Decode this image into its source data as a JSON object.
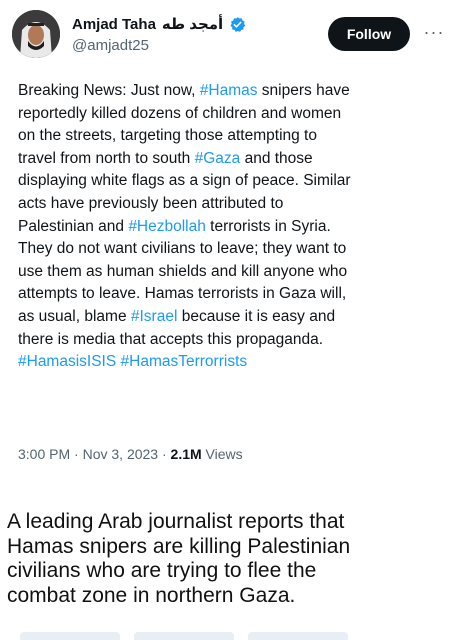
{
  "tweet": {
    "author_name": "Amjad Taha",
    "author_name_arabic": "أمجد طه",
    "handle": "@amjadt25",
    "follow_label": "Follow",
    "more_label": "···",
    "lines": [
      [
        {
          "t": "Breaking News: Just now, "
        },
        {
          "t": "#Hamas",
          "tag": true
        },
        {
          "t": " snipers have"
        }
      ],
      [
        {
          "t": "reportedly killed dozens of children and women"
        }
      ],
      [
        {
          "t": "on the streets, targeting those attempting to"
        }
      ],
      [
        {
          "t": "travel from north to south "
        },
        {
          "t": "#Gaza",
          "tag": true
        },
        {
          "t": " and those"
        }
      ],
      [
        {
          "t": "displaying white flags as a sign of peace. Similar"
        }
      ],
      [
        {
          "t": "acts have previously been attributed to"
        }
      ],
      [
        {
          "t": "Palestinian and "
        },
        {
          "t": "#Hezbollah",
          "tag": true
        },
        {
          "t": " terrorists in Syria."
        }
      ],
      [
        {
          "t": "They do not want civilians to leave; they want to"
        }
      ],
      [
        {
          "t": "use them as human shields and kill anyone who"
        }
      ],
      [
        {
          "t": "attempts to leave. Hamas terrorists in Gaza will,"
        }
      ],
      [
        {
          "t": "as usual, blame "
        },
        {
          "t": "#Israel",
          "tag": true
        },
        {
          "t": " because it is easy and"
        }
      ],
      [
        {
          "t": "there is media that accepts this propaganda."
        }
      ],
      [
        {
          "t": "#HamasisISIS",
          "tag": true
        },
        {
          "t": " "
        },
        {
          "t": "#HamasTerrorrists",
          "tag": true
        }
      ]
    ],
    "time": "3:00 PM",
    "separator": " · ",
    "date": "Nov 3, 2023",
    "views_count": "2.1M",
    "views_label": " Views"
  },
  "caption": {
    "lines": [
      "A leading Arab journalist reports that",
      "Hamas snipers are killing Palestinian",
      "civilians who are trying to flee the",
      "combat zone in northern Gaza."
    ]
  },
  "colors": {
    "hashtag": "#1d9bf0",
    "verified": "#1d9bf0",
    "follow_bg": "#0f1419",
    "secondary_text": "#536471"
  },
  "icons": {
    "verified": "verified-badge-icon",
    "more": "more-horizontal-icon"
  }
}
